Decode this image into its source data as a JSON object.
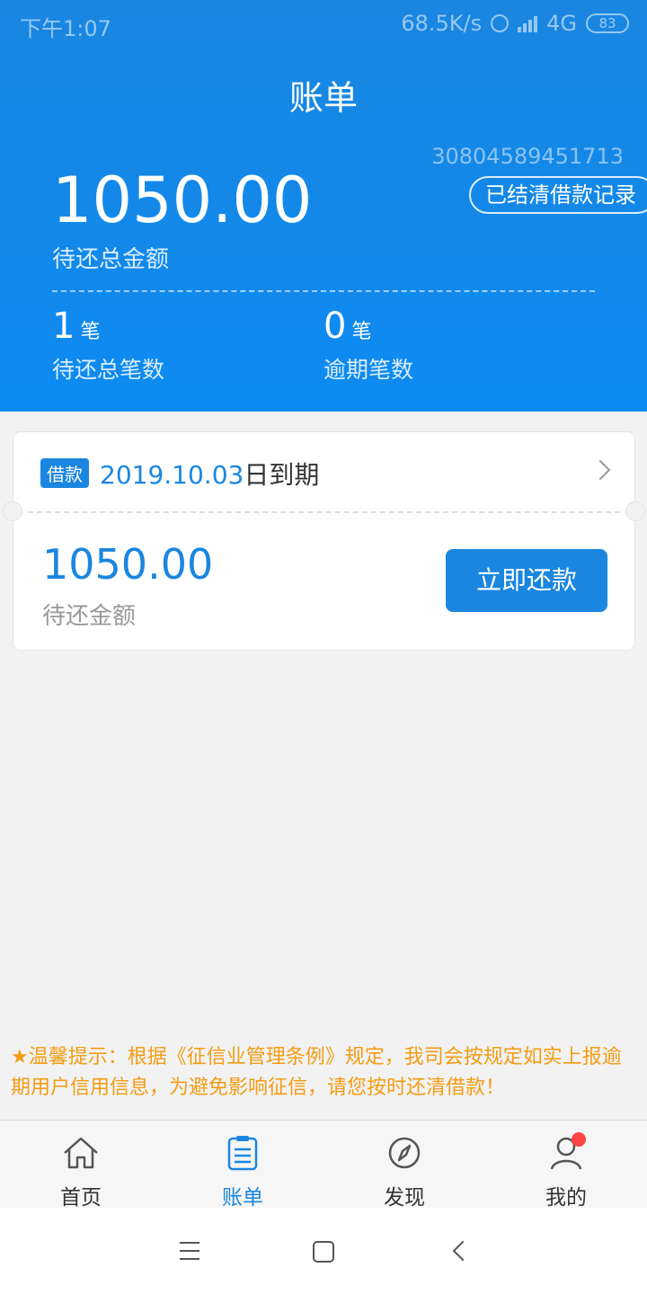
{
  "status": {
    "time": "下午1:07",
    "speed": "68.5K/s",
    "network": "4G",
    "battery": "83"
  },
  "header": {
    "title": "账单",
    "account_no": "30804589451713",
    "settled_button": "已结清借款记录",
    "total_amount": "1050.00",
    "total_label": "待还总金额",
    "stats": [
      {
        "value": "1",
        "unit": "笔",
        "label": "待还总笔数"
      },
      {
        "value": "0",
        "unit": "笔",
        "label": "逾期笔数"
      }
    ]
  },
  "bill": {
    "tag": "借款",
    "due_date": "2019.10.03",
    "due_suffix": "日到期",
    "amount": "1050.00",
    "amount_label": "待还金额",
    "pay_button": "立即还款"
  },
  "tip": "★温馨提示：根据《征信业管理条例》规定，我司会按规定如实上报逾期用户信用信息，为避免影响征信，请您按时还清借款！",
  "tabs": [
    {
      "label": "首页",
      "icon": "home-icon"
    },
    {
      "label": "账单",
      "icon": "bill-icon",
      "active": true
    },
    {
      "label": "发现",
      "icon": "compass-icon"
    },
    {
      "label": "我的",
      "icon": "user-icon"
    }
  ],
  "colors": {
    "primary": "#1a86e0",
    "tip": "#f39c12",
    "badge": "#ff4444"
  }
}
